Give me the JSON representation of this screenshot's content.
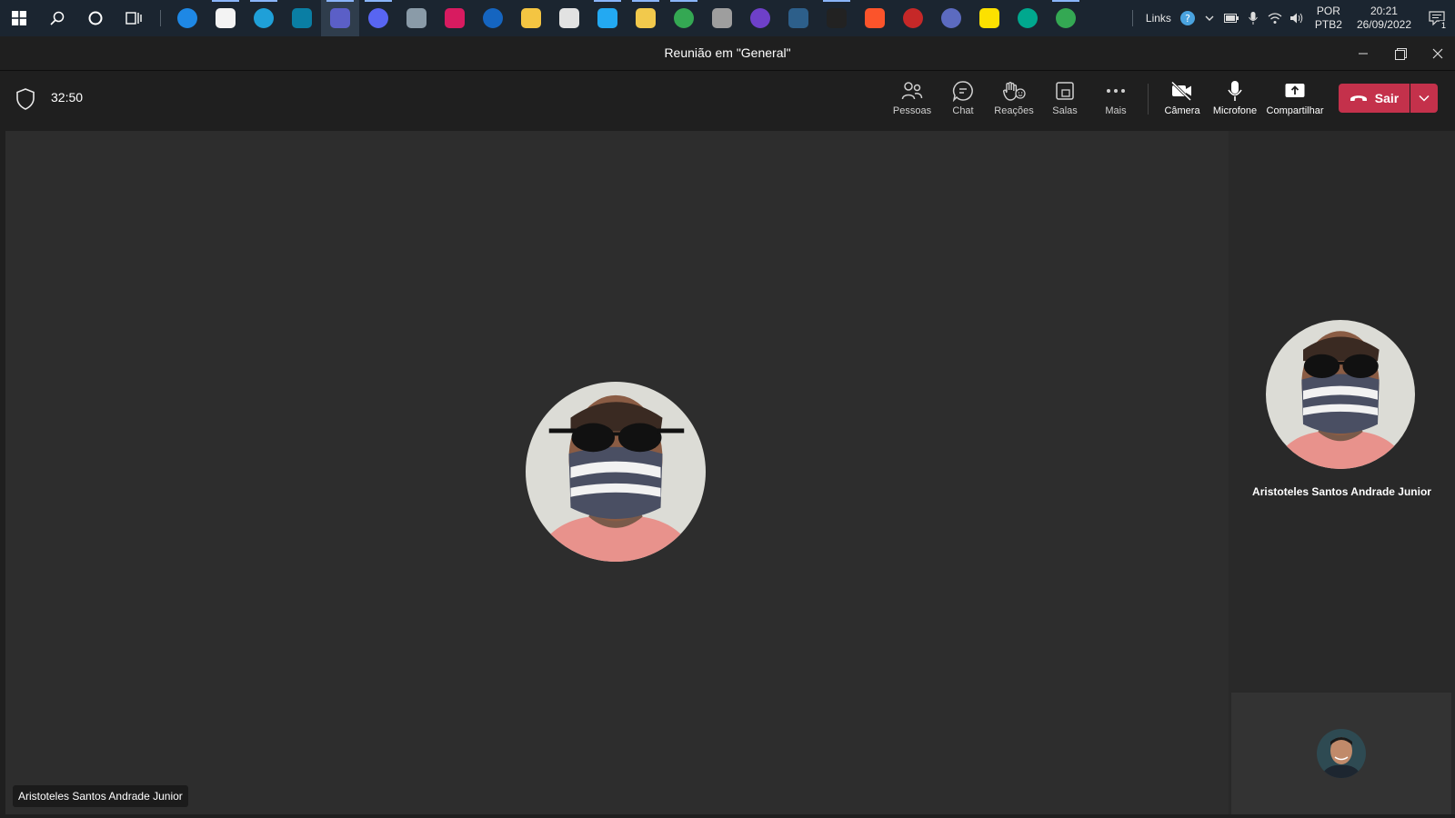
{
  "taskbar": {
    "apps": [
      {
        "icon": "windows-start-icon",
        "color": "#ffffff"
      },
      {
        "icon": "search-icon",
        "color": "#ffffff"
      },
      {
        "icon": "cortana-icon",
        "color": "#ffffff"
      },
      {
        "icon": "task-view-icon",
        "color": "#ffffff"
      },
      {
        "icon": "ccleaner-icon",
        "color": "#1e88e5"
      },
      {
        "icon": "microsoft-store-icon",
        "color": "#f3f3f3"
      },
      {
        "icon": "edge-icon",
        "color": "#1fa0d8"
      },
      {
        "icon": "panel-app-icon",
        "color": "#0a7ea4"
      },
      {
        "icon": "teams-icon",
        "color": "#5b5fc7"
      },
      {
        "icon": "discord-icon",
        "color": "#5865f2"
      },
      {
        "icon": "calculator-icon",
        "color": "#8a9ba8"
      },
      {
        "icon": "bars-app-icon",
        "color": "#d81b60"
      },
      {
        "icon": "pixel-app-icon",
        "color": "#1565c0"
      },
      {
        "icon": "lightbulb-icon",
        "color": "#f4c542"
      },
      {
        "icon": "git-icon",
        "color": "#e2e2e2"
      },
      {
        "icon": "vscode-icon",
        "color": "#23a9f2"
      },
      {
        "icon": "file-explorer-icon",
        "color": "#f2c94c"
      },
      {
        "icon": "chrome-icon",
        "color": "#34a853"
      },
      {
        "icon": "camera-app-icon",
        "color": "#9e9e9e"
      },
      {
        "icon": "github-icon",
        "color": "#6e40c9"
      },
      {
        "icon": "wave-app-icon",
        "color": "#2d5f8a"
      },
      {
        "icon": "terminal-icon",
        "color": "#222222"
      },
      {
        "icon": "brave-icon",
        "color": "#fb542b"
      },
      {
        "icon": "red-app-icon",
        "color": "#c62828"
      },
      {
        "icon": "lines-app-icon",
        "color": "#5c6bc0"
      },
      {
        "icon": "sticky-notes-icon",
        "color": "#fce100"
      },
      {
        "icon": "kaspersky-icon",
        "color": "#00a88e"
      },
      {
        "icon": "chrome-icon",
        "color": "#34a853"
      }
    ],
    "links_label": "Links",
    "lang_top": "POR",
    "lang_bottom": "PTB2",
    "time": "20:21",
    "date": "26/09/2022",
    "notification_count": "1"
  },
  "window": {
    "title": "Reunião em \"General\""
  },
  "meeting": {
    "timer": "32:50",
    "tools": {
      "people": "Pessoas",
      "chat": "Chat",
      "reactions": "Reações",
      "rooms": "Salas",
      "more": "Mais",
      "camera": "Câmera",
      "mic": "Microfone",
      "share": "Compartilhar"
    },
    "leave_label": "Sair",
    "leave_color": "#c4314b"
  },
  "participants": {
    "main_name": "Aristoteles Santos Andrade Junior",
    "side_name": "Aristoteles Santos Andrade Junior"
  }
}
